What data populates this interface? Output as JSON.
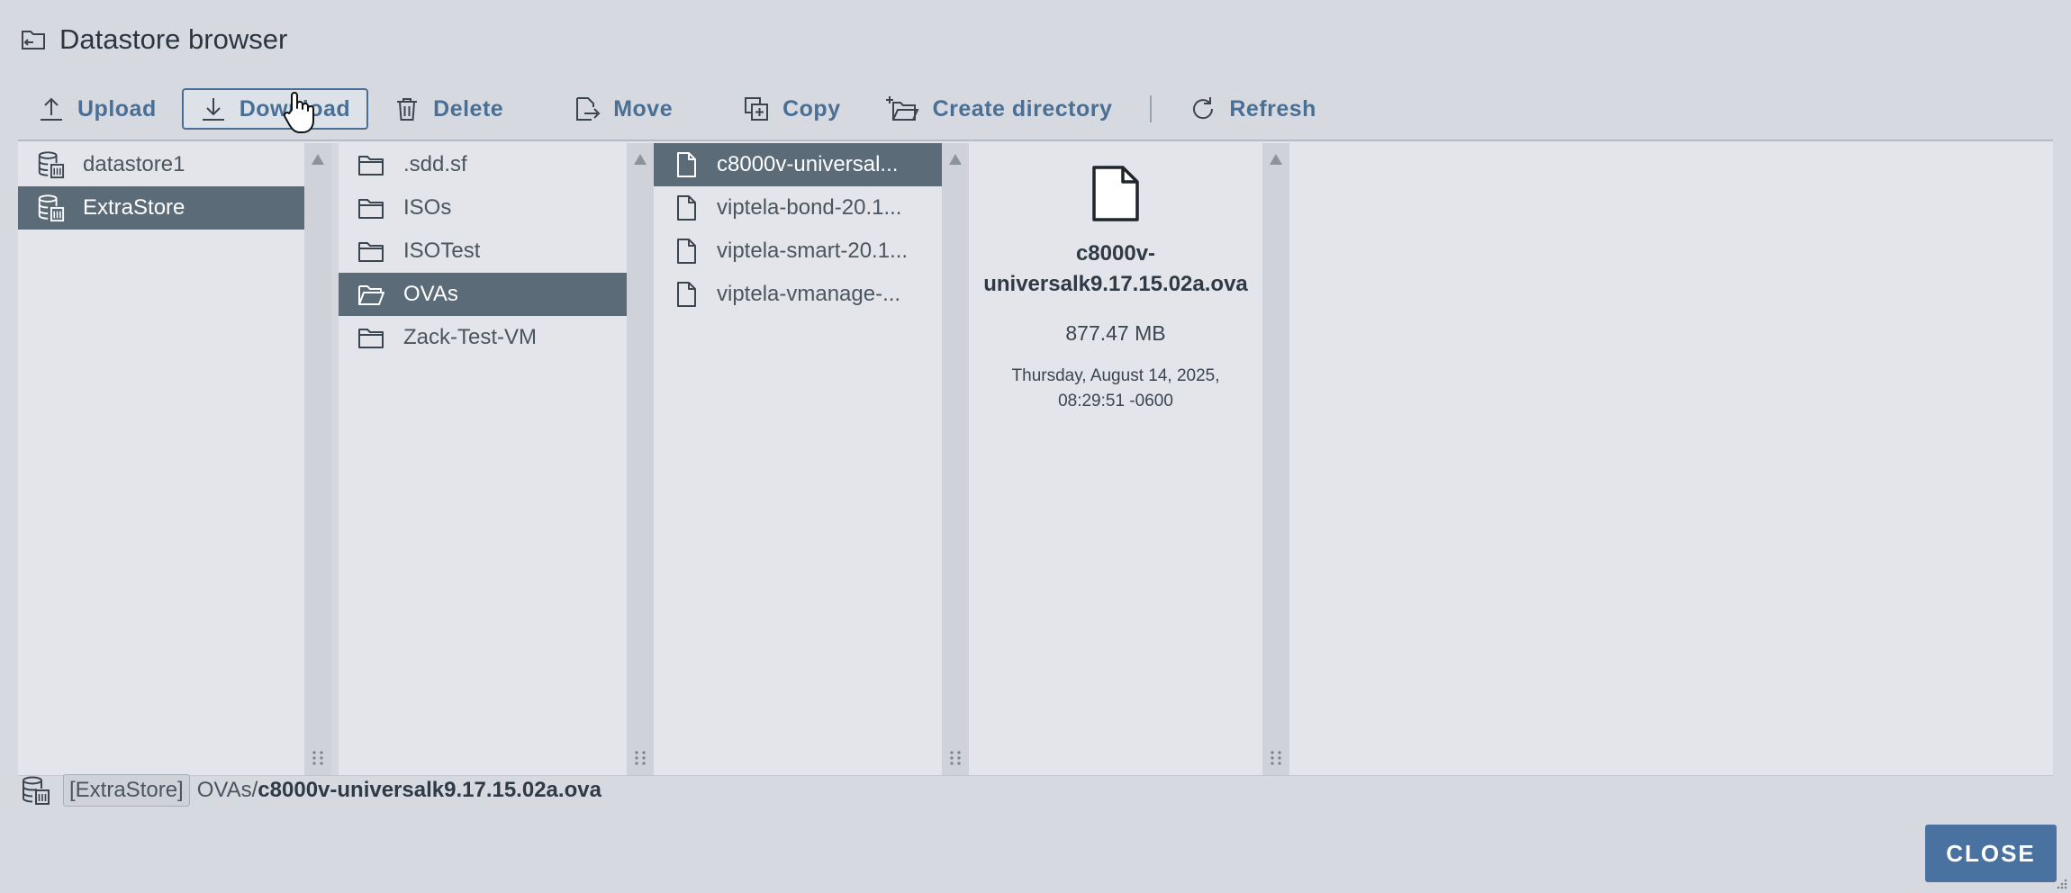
{
  "dialog": {
    "title": "Datastore browser",
    "title_icon": "folder-browser-icon"
  },
  "toolbar": {
    "upload": "Upload",
    "download": "Download",
    "delete": "Delete",
    "move": "Move",
    "copy": "Copy",
    "create_directory": "Create directory",
    "refresh": "Refresh",
    "active_button": "Download"
  },
  "datastores": [
    {
      "label": "datastore1",
      "selected": false
    },
    {
      "label": "ExtraStore",
      "selected": true
    }
  ],
  "folders": [
    {
      "label": ".sdd.sf",
      "selected": false
    },
    {
      "label": "ISOs",
      "selected": false
    },
    {
      "label": "ISOTest",
      "selected": false
    },
    {
      "label": "OVAs",
      "selected": true
    },
    {
      "label": "Zack-Test-VM",
      "selected": false
    }
  ],
  "files": [
    {
      "label": "c8000v-universal...",
      "selected": true
    },
    {
      "label": "viptela-bond-20.1...",
      "selected": false
    },
    {
      "label": "viptela-smart-20.1...",
      "selected": false
    },
    {
      "label": "viptela-vmanage-...",
      "selected": false
    }
  ],
  "details": {
    "file_name_line1": "c8000v-",
    "file_name_line2": "universalk9.17.15.02a.ova",
    "size": "877.47 MB",
    "date_line1": "Thursday, August 14, 2025,",
    "date_line2": "08:29:51 -0600"
  },
  "path": {
    "datastore_tag": "[ExtraStore]",
    "directory": "OVAs/",
    "file": "c8000v-universalk9.17.15.02a.ova"
  },
  "footer": {
    "close": "CLOSE"
  },
  "colors": {
    "accent": "#4a6f95",
    "selected_row": "#5b6b78",
    "close_button": "#4a72a0",
    "background": "#d7d9e0"
  }
}
